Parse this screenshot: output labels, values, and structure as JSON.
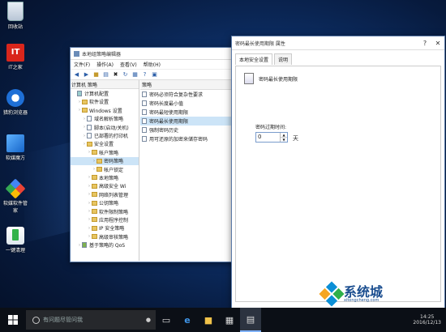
{
  "desktop": {
    "icons": [
      {
        "label": "回收站",
        "icon": "recycle-bin-icon"
      },
      {
        "label": "IT之家",
        "icon": "ithome-icon",
        "badge": "IT"
      },
      {
        "label": "猎豹浏览器",
        "icon": "browser-icon"
      },
      {
        "label": "软媒魔方",
        "icon": "cube-icon"
      },
      {
        "label": "软媒软件管家",
        "icon": "software-manager-icon"
      },
      {
        "label": "一键清理",
        "icon": "cleanup-icon"
      }
    ]
  },
  "gpedit": {
    "title": "本地组策略编辑器",
    "menu": [
      "文件(F)",
      "操作(A)",
      "查看(V)",
      "帮助(H)"
    ],
    "tree_header": "计算机 策略",
    "tree": [
      {
        "label": "计算机配置",
        "level": 0,
        "type": "pc"
      },
      {
        "label": "软件设置",
        "level": 1,
        "type": "folder"
      },
      {
        "label": "Windows 设置",
        "level": 1,
        "type": "folder"
      },
      {
        "label": "域名解析策略",
        "level": 2,
        "type": "doc"
      },
      {
        "label": "脚本(启动/关机)",
        "level": 2,
        "type": "doc"
      },
      {
        "label": "已部署的打印机",
        "level": 2,
        "type": "doc"
      },
      {
        "label": "安全设置",
        "level": 2,
        "type": "folder"
      },
      {
        "label": "帐户策略",
        "level": 3,
        "type": "folder"
      },
      {
        "label": "密码策略",
        "level": 4,
        "type": "folder",
        "selected": true
      },
      {
        "label": "帐户锁定",
        "level": 4,
        "type": "folder"
      },
      {
        "label": "本地策略",
        "level": 3,
        "type": "folder"
      },
      {
        "label": "高级安全 Wi",
        "level": 3,
        "type": "folder"
      },
      {
        "label": "网络列表管理",
        "level": 3,
        "type": "folder"
      },
      {
        "label": "公钥策略",
        "level": 3,
        "type": "folder"
      },
      {
        "label": "软件限制策略",
        "level": 3,
        "type": "folder"
      },
      {
        "label": "应用程序控制",
        "level": 3,
        "type": "folder"
      },
      {
        "label": "IP 安全策略",
        "level": 3,
        "type": "folder"
      },
      {
        "label": "高级审核策略",
        "level": 3,
        "type": "folder"
      },
      {
        "label": "基于策略的 QoS",
        "level": 1,
        "type": "chart"
      }
    ],
    "list_header": "策略",
    "policies": [
      {
        "label": "密码必须符合复杂性要求"
      },
      {
        "label": "密码长度最小值"
      },
      {
        "label": "密码最短使用期限"
      },
      {
        "label": "密码最长使用期限",
        "selected": true
      },
      {
        "label": "强制密码历史"
      },
      {
        "label": "用可还原的加密来储存密码"
      }
    ]
  },
  "props": {
    "title": "密码最长使用期限 属性",
    "tabs": [
      "本地安全设置",
      "说明"
    ],
    "policy_name": "密码最长使用期限",
    "expire_label": "密码过期时间:",
    "days_value": "0",
    "unit": "天"
  },
  "taskbar": {
    "search_placeholder": "有问题尽管问我",
    "time": "14:25",
    "date": "2016/12/13"
  },
  "watermark": {
    "text": "系统城",
    "url": "xitongcheng.com"
  }
}
